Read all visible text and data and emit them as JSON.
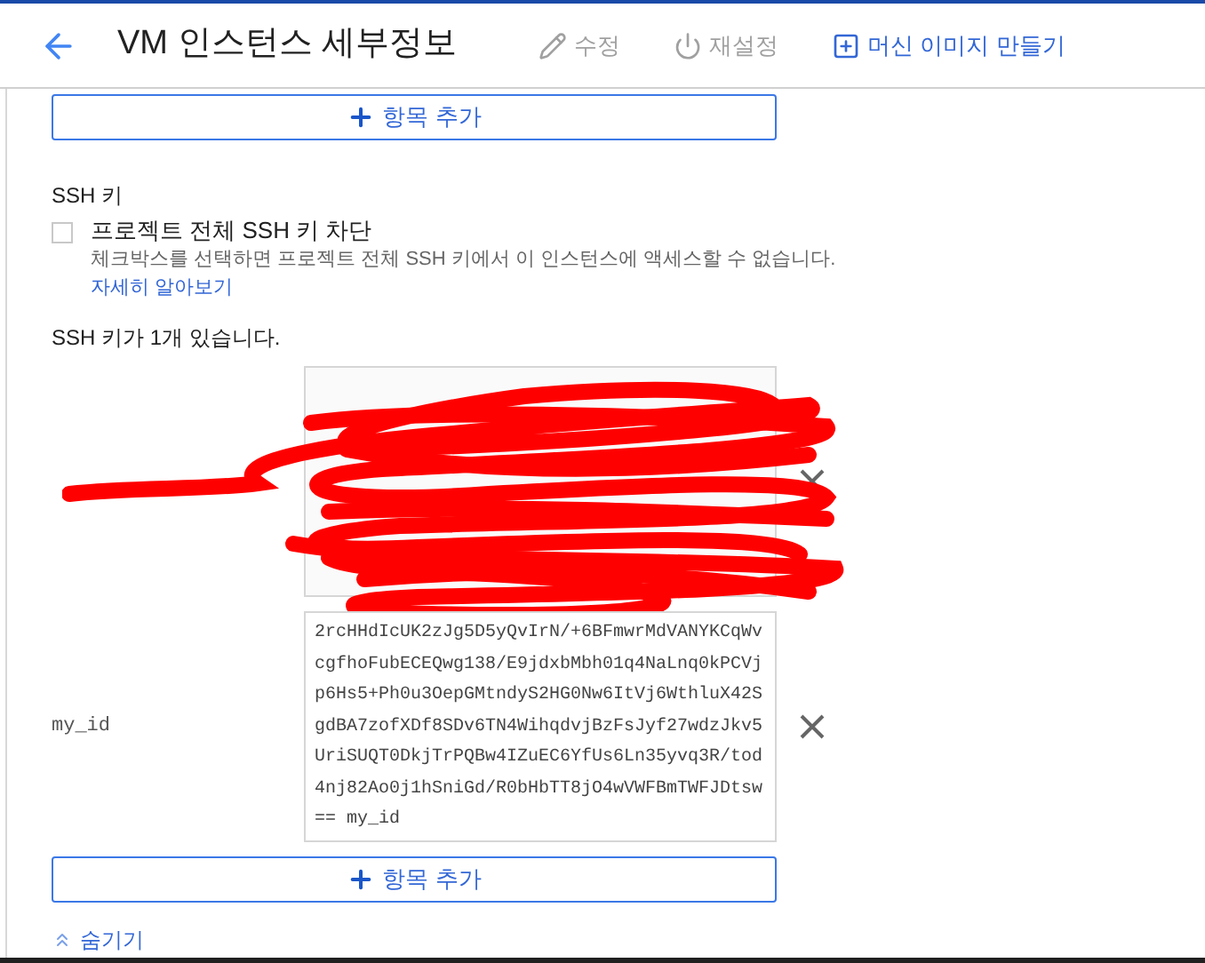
{
  "header": {
    "title": "VM 인스턴스 세부정보",
    "actions": [
      {
        "label": "수정",
        "kind": "edit",
        "disabled": true
      },
      {
        "label": "재설정",
        "kind": "reset",
        "disabled": true
      },
      {
        "label": "머신 이미지 만들기",
        "kind": "create",
        "disabled": false
      }
    ]
  },
  "add_item_top": {
    "label": "항목 추가"
  },
  "ssh": {
    "heading": "SSH 키",
    "block_checkbox": {
      "label": "프로젝트 전체 SSH 키 차단",
      "checked": false
    },
    "description": "체크박스를 선택하면 프로젝트 전체 SSH 키에서 이 인스턴스에 액세스할 수 없습니다.",
    "learn_more": "자세히 알아보기",
    "count_text": "SSH 키가 1개 있습니다.",
    "keys": [
      {
        "redacted": true
      },
      {
        "redacted": false,
        "label": "my_id",
        "lines": [
          "2rcHHdIcUK2zJg5D5yQvIrN/+6BFmwrMdVANYKCqWv",
          "cgfhoFubECEQwg138/E9jdxbMbh01q4NaLnq0kPCVj",
          "p6Hs5+Ph0u3OepGMtndyS2HG0Nw6ItVj6WthluX42S",
          "gdBA7zofXDf8SDv6TN4WihqdvjBzFsJyf27wdzJkv5",
          "UriSUQT0DkjTrPQBw4IZuEC6YfUs6Ln35yvq3R/tod",
          "4nj82Ao0j1hSniGd/R0bHbTT8jO4wVWFBmTWFJDtsw",
          "== my_id"
        ]
      }
    ],
    "add_item": {
      "label": "항목 추가"
    },
    "hide_link": {
      "label": "숨기기"
    }
  }
}
